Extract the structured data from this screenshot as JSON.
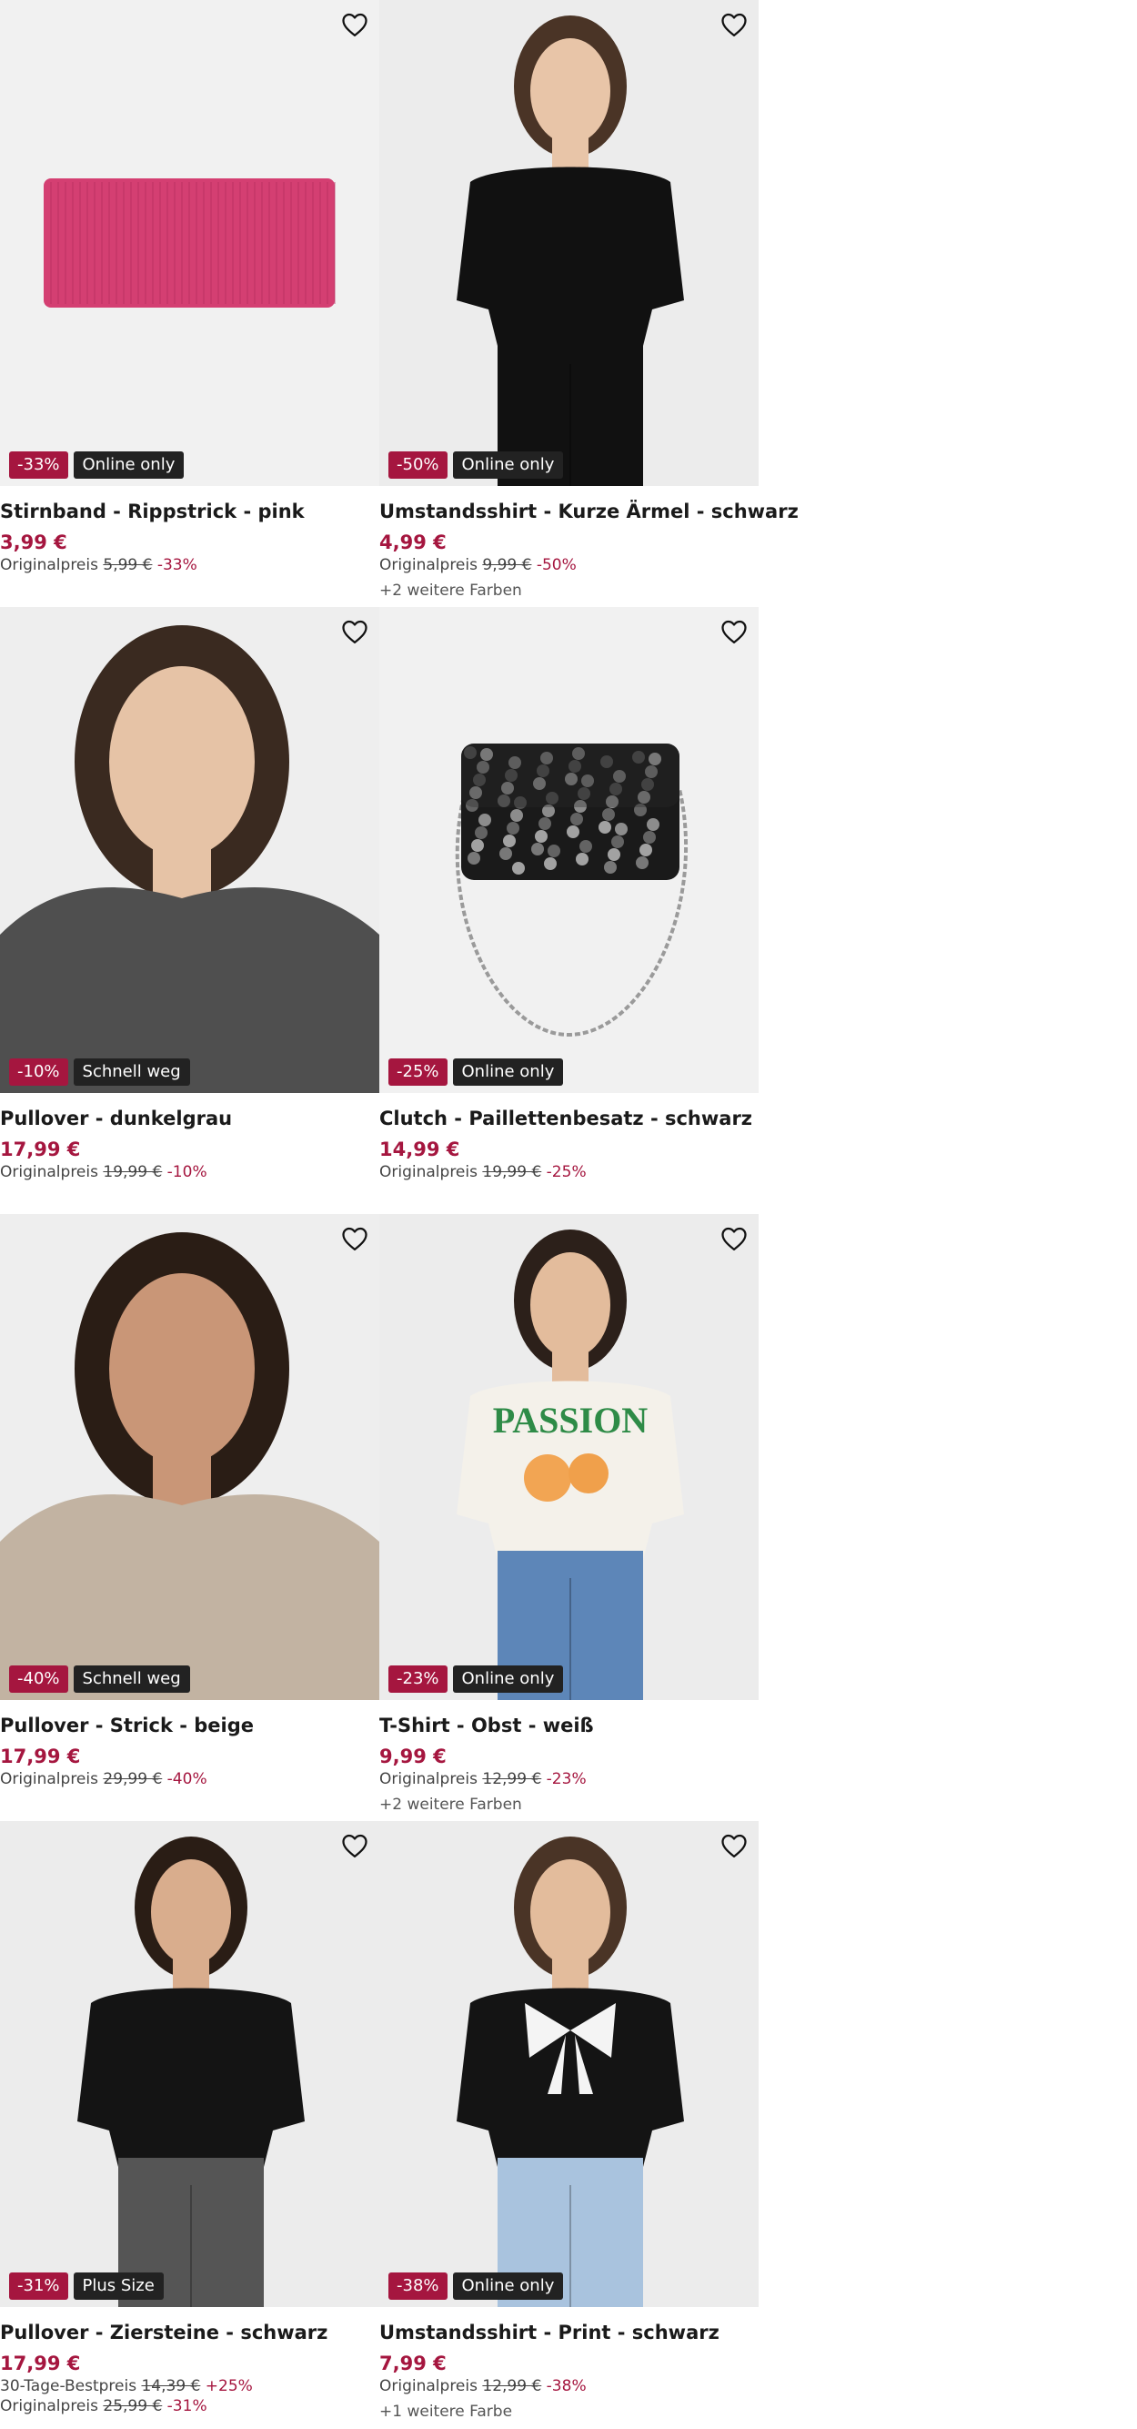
{
  "products": [
    {
      "name": "Stirnband - Rippstrick - pink",
      "price": "3,99 €",
      "discount": "-33%",
      "tag": "Online only",
      "lines": [
        {
          "label": "Originalpreis",
          "old": "5,99 €",
          "pct": "-33%"
        }
      ],
      "more": "",
      "image": {
        "kind": "headband",
        "bg": "#f1f1f1",
        "color": "#d43f72"
      }
    },
    {
      "name": "Umstandsshirt - Kurze Ärmel - schwarz",
      "price": "4,99 €",
      "discount": "-50%",
      "tag": "Online only",
      "lines": [
        {
          "label": "Originalpreis",
          "old": "9,99 €",
          "pct": "-50%"
        }
      ],
      "more": "+2 weitere Farben",
      "image": {
        "kind": "person",
        "bg": "#ececec",
        "color": "#111111",
        "skin": "#e8c5a8",
        "hair": "#4a3426",
        "legs": "#111111"
      }
    },
    {
      "name": "Pullover - dunkelgrau",
      "price": "17,99 €",
      "discount": "-10%",
      "tag": "Schnell weg",
      "lines": [
        {
          "label": "Originalpreis",
          "old": "19,99 €",
          "pct": "-10%"
        }
      ],
      "more": "",
      "image": {
        "kind": "portrait",
        "bg": "#eeeeee",
        "color": "#4f4f4f",
        "skin": "#e6c3a6",
        "hair": "#3a2a20"
      }
    },
    {
      "name": "Clutch - Paillettenbesatz - schwarz",
      "price": "14,99 €",
      "discount": "-25%",
      "tag": "Online only",
      "lines": [
        {
          "label": "Originalpreis",
          "old": "19,99 €",
          "pct": "-25%"
        }
      ],
      "more": "",
      "image": {
        "kind": "bag",
        "bg": "#f1f1f1",
        "color": "#1a1a1a"
      }
    },
    {
      "name": "Pullover - Strick - beige",
      "price": "17,99 €",
      "discount": "-40%",
      "tag": "Schnell weg",
      "lines": [
        {
          "label": "Originalpreis",
          "old": "29,99 €",
          "pct": "-40%"
        }
      ],
      "more": "",
      "image": {
        "kind": "portrait",
        "bg": "#eeeeee",
        "color": "#c2b3a2",
        "skin": "#c99677",
        "hair": "#2a1d15"
      }
    },
    {
      "name": "T-Shirt - Obst - weiß",
      "price": "9,99 €",
      "discount": "-23%",
      "tag": "Online only",
      "lines": [
        {
          "label": "Originalpreis",
          "old": "12,99 €",
          "pct": "-23%"
        }
      ],
      "more": "+2 weitere Farben",
      "image": {
        "kind": "person",
        "bg": "#ececec",
        "color": "#f4f1ea",
        "skin": "#e3bc9c",
        "hair": "#2c201a",
        "legs": "#5d86b8",
        "print": "PASSION"
      }
    },
    {
      "name": "Pullover - Ziersteine - schwarz",
      "price": "17,99 €",
      "discount": "-31%",
      "tag": "Plus Size",
      "lines": [
        {
          "label": "30-Tage-Bestpreis",
          "old": "14,39 €",
          "pct": "+25%"
        },
        {
          "label": "Originalpreis",
          "old": "25,99 €",
          "pct": "-31%"
        }
      ],
      "more": "",
      "image": {
        "kind": "person",
        "bg": "#ececec",
        "color": "#141414",
        "skin": "#d9ad8d",
        "hair": "#2a1d15",
        "legs": "#555555"
      }
    },
    {
      "name": "Umstandsshirt - Print - schwarz",
      "price": "7,99 €",
      "discount": "-38%",
      "tag": "Online only",
      "lines": [
        {
          "label": "Originalpreis",
          "old": "12,99 €",
          "pct": "-38%"
        }
      ],
      "more": "+1 weitere Farbe",
      "image": {
        "kind": "person",
        "bg": "#ececec",
        "color": "#141414",
        "skin": "#e3bc9c",
        "hair": "#4a3426",
        "legs": "#a9c3de",
        "bow": true
      }
    }
  ]
}
